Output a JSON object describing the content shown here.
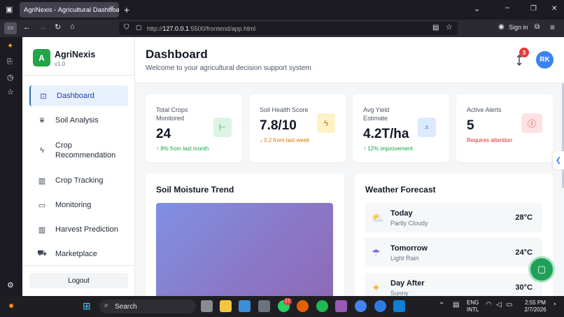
{
  "browser": {
    "tab_title": "AgriNexis - Agricultural Dashboard",
    "url_prefix": "http://",
    "url_host": "127.0.0.1",
    "url_rest": ":5500/frontend/app.html",
    "sign_in": "Sign in"
  },
  "sidebar": {
    "logo_letter": "A",
    "brand": "AgriNexis",
    "version": "v1.0",
    "items": [
      {
        "label": "Dashboard",
        "icon": "dashboard-icon",
        "active": true
      },
      {
        "label": "Soil Analysis",
        "icon": "soil-icon"
      },
      {
        "label": "Crop\nRecommendation",
        "icon": "lightning-icon"
      },
      {
        "label": "Crop Tracking",
        "icon": "bar-chart-icon"
      },
      {
        "label": "Monitoring",
        "icon": "camera-icon"
      },
      {
        "label": "Harvest Prediction",
        "icon": "bar-chart-icon"
      },
      {
        "label": "Marketplace",
        "icon": "cart-icon"
      }
    ],
    "logout": "Logout"
  },
  "header": {
    "title": "Dashboard",
    "subtitle": "Welcome to your agricultural decision support system",
    "notification_count": "3",
    "avatar_initials": "RK"
  },
  "stats": [
    {
      "label": "Total Crops Monitored",
      "value": "24",
      "change": "↑ 8% from last month",
      "change_color": "#16a34a",
      "icon_bg": "#dcf5e3",
      "icon_color": "#16a34a"
    },
    {
      "label": "Soil Health Score",
      "value": "7.8/10",
      "change": "↓ 0.2 from last week",
      "change_color": "#d97706",
      "icon_bg": "#fef3c7",
      "icon_color": "#d97706"
    },
    {
      "label": "Avg Yield Estimate",
      "value": "4.2T/ha",
      "change": "↑ 12% improvement",
      "change_color": "#16a34a",
      "icon_bg": "#dbeafe",
      "icon_color": "#2563eb"
    },
    {
      "label": "Active Alerts",
      "value": "5",
      "change": "Requires attention",
      "change_color": "#dc2626",
      "icon_bg": "#fde2e2",
      "icon_color": "#dc2626"
    }
  ],
  "soil_panel": {
    "title": "Soil Moisture Trend"
  },
  "weather": {
    "title": "Weather Forecast",
    "days": [
      {
        "day": "Today",
        "condition": "Partly Cloudy",
        "temp": "28°C",
        "icon": "partly-cloudy-icon"
      },
      {
        "day": "Tomorrow",
        "condition": "Light Rain",
        "temp": "24°C",
        "icon": "rain-icon"
      },
      {
        "day": "Day After",
        "condition": "Sunny",
        "temp": "30°C",
        "icon": "sun-icon"
      }
    ]
  },
  "taskbar": {
    "search": "Search",
    "lang1": "ENG",
    "lang2": "INTL",
    "time": "2:55 PM",
    "date": "2/7/2026",
    "whatsapp_badge": "17"
  }
}
